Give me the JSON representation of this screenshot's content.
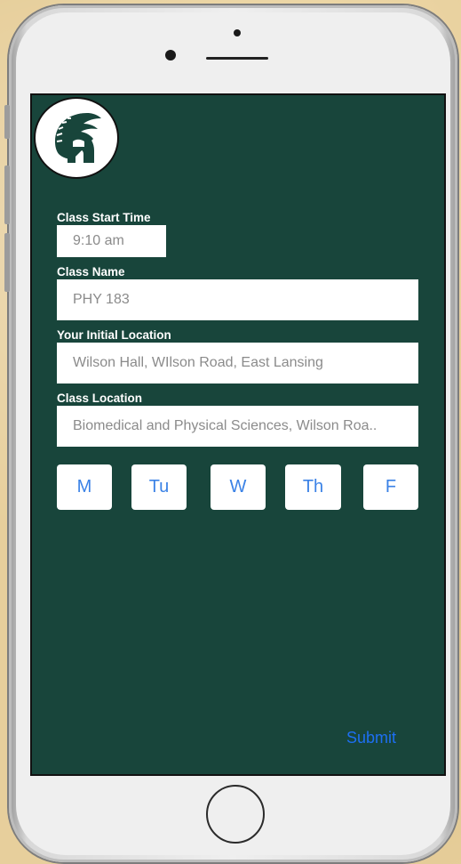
{
  "form": {
    "start_time_label": "Class Start Time",
    "start_time_value": "9:10 am",
    "class_name_label": "Class Name",
    "class_name_value": "PHY 183",
    "initial_location_label": "Your Initial Location",
    "initial_location_value": "Wilson Hall, WIlson Road, East Lansing",
    "class_location_label": "Class Location",
    "class_location_value": "Biomedical and Physical Sciences, Wilson Roa.."
  },
  "days": [
    "M",
    "Tu",
    "W",
    "Th",
    "F"
  ],
  "submit_label": "Submit",
  "logo_icon": "spartan-helmet-icon",
  "colors": {
    "screen_background": "#18453b",
    "accent_blue": "#1d6ff2",
    "day_text": "#3b82e6"
  }
}
